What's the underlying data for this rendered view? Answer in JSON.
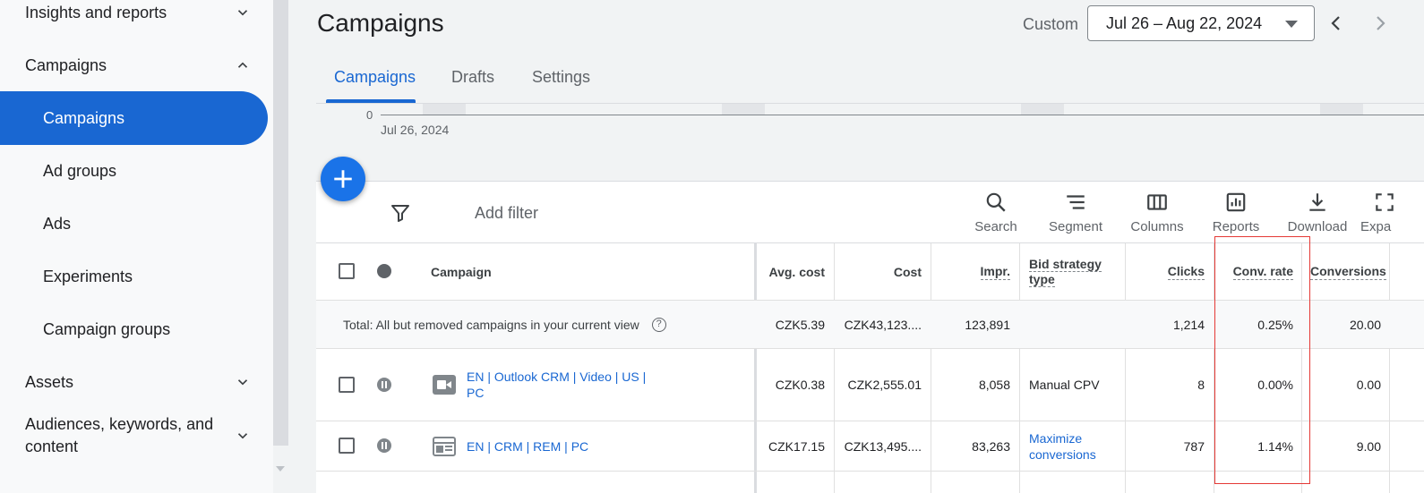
{
  "sidebar": {
    "items": [
      {
        "label": "Insights and reports",
        "expand": "chevron-down"
      },
      {
        "label": "Campaigns",
        "expand": "chevron-up"
      },
      {
        "label": "Campaigns"
      },
      {
        "label": "Ad groups"
      },
      {
        "label": "Ads"
      },
      {
        "label": "Experiments"
      },
      {
        "label": "Campaign groups"
      },
      {
        "label": "Assets",
        "expand": "chevron-down"
      },
      {
        "label_line1": "Audiences, keywords, and",
        "label_line2": "content",
        "expand": "chevron-down"
      }
    ]
  },
  "header": {
    "title": "Campaigns",
    "date_range_type": "Custom",
    "date_range": "Jul 26 – Aug 22, 2024"
  },
  "tabs": [
    "Campaigns",
    "Drafts",
    "Settings"
  ],
  "chart_strip": {
    "y_zero_label": "0",
    "x_start_label": "Jul 26, 2024"
  },
  "toolbar": {
    "add_filter": "Add filter",
    "tools": [
      "Search",
      "Segment",
      "Columns",
      "Reports",
      "Download",
      "Expa"
    ]
  },
  "table": {
    "columns": {
      "campaign": "Campaign",
      "avg_cost": "Avg. cost",
      "cost": "Cost",
      "impr": "Impr.",
      "bid_line1": "Bid strategy",
      "bid_line2": "type",
      "clicks": "Clicks",
      "conv_rate": "Conv. rate",
      "conversions": "Conversions"
    },
    "total": {
      "label": "Total: All but removed campaigns in your current view",
      "avg_cost": "CZK5.39",
      "cost": "CZK43,123....",
      "impr": "123,891",
      "bid": "",
      "clicks": "1,214",
      "conv_rate": "0.25%",
      "conversions": "20.00"
    },
    "rows": [
      {
        "name_line1": "EN | Outlook CRM | Video | US |",
        "name_line2": "PC",
        "type_icon": "video-campaign-icon",
        "status": "paused",
        "avg_cost": "CZK0.38",
        "cost": "CZK2,555.01",
        "impr": "8,058",
        "bid": "Manual CPV",
        "clicks": "8",
        "conv_rate": "0.00%",
        "conversions": "0.00"
      },
      {
        "name_line1": "EN | CRM | REM | PC",
        "type_icon": "display-campaign-icon",
        "status": "paused",
        "avg_cost": "CZK17.15",
        "cost": "CZK13,495....",
        "impr": "83,263",
        "bid_line1": "Maximize",
        "bid_line2": "conversions",
        "clicks": "787",
        "conv_rate": "1.14%",
        "conversions": "9.00"
      }
    ]
  },
  "colors": {
    "accent": "#1967d2",
    "highlight": "#e53935"
  }
}
